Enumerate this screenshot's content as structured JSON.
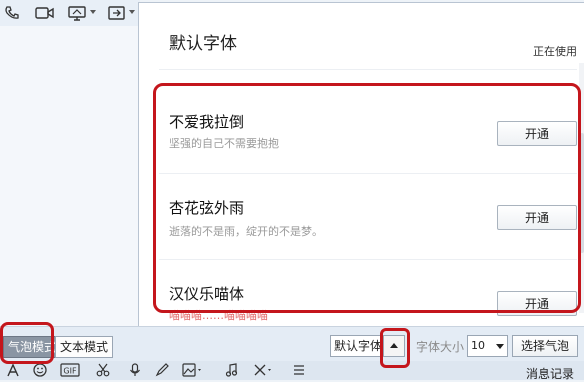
{
  "panel": {
    "title": "默认字体",
    "current_status": "正在使用"
  },
  "fonts": [
    {
      "name": "不爱我拉倒",
      "sample": "坚强的自己不需要抱抱",
      "button": "开通"
    },
    {
      "name": "杏花弦外雨",
      "sample": "逝落的不是雨，绽开的不是梦。",
      "button": "开通"
    },
    {
      "name": "汉仪乐喵体",
      "sample": "喵喵喵……喵喵喵喵",
      "button": "开通"
    }
  ],
  "bottom_bar": {
    "bubble_mode": "气泡模式",
    "text_mode": "文本模式",
    "font_select": "默认字体",
    "size_label": "字体大小",
    "size_value": "10",
    "choose_bubble": "选择气泡"
  },
  "icon_row": {
    "history": "消息记录"
  },
  "colors": {
    "highlight": "#c4161c",
    "active_mode": "#8a95a3"
  },
  "icons": [
    "phone-icon",
    "video-icon",
    "screen-share-icon",
    "transfer-icon",
    "font-icon",
    "emoji-icon",
    "gif-icon",
    "scissors-icon",
    "voice-icon",
    "paint-icon",
    "image-icon",
    "music-icon",
    "delete-icon",
    "more-icon"
  ]
}
